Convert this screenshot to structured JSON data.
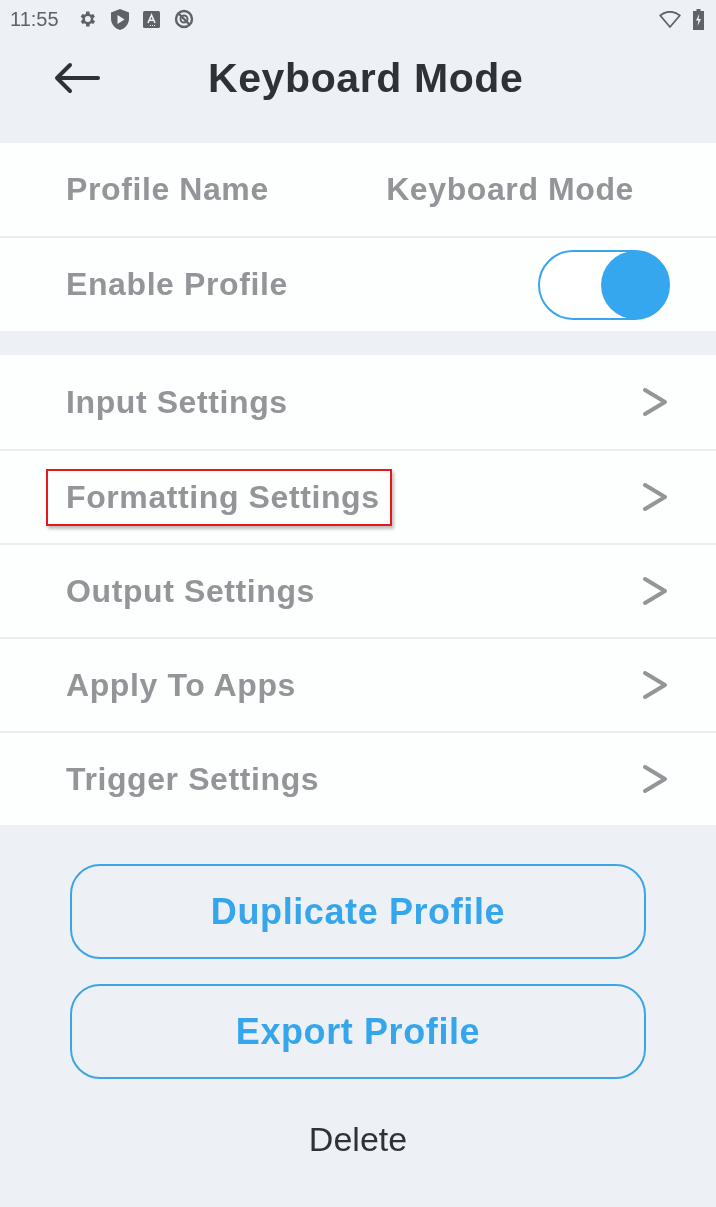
{
  "status_bar": {
    "time": "11:55"
  },
  "header": {
    "title": "Keyboard Mode"
  },
  "profile": {
    "name_label": "Profile Name",
    "name_value": "Keyboard Mode",
    "enable_label": "Enable Profile",
    "enabled": true
  },
  "menu": [
    {
      "label": "Input Settings",
      "highlighted": false
    },
    {
      "label": "Formatting Settings",
      "highlighted": true
    },
    {
      "label": "Output Settings",
      "highlighted": false
    },
    {
      "label": "Apply To Apps",
      "highlighted": false
    },
    {
      "label": "Trigger Settings",
      "highlighted": false
    }
  ],
  "buttons": [
    {
      "label": "Duplicate Profile",
      "kind": "outlined"
    },
    {
      "label": "Export Profile",
      "kind": "outlined"
    },
    {
      "label": "Delete",
      "kind": "text"
    }
  ]
}
